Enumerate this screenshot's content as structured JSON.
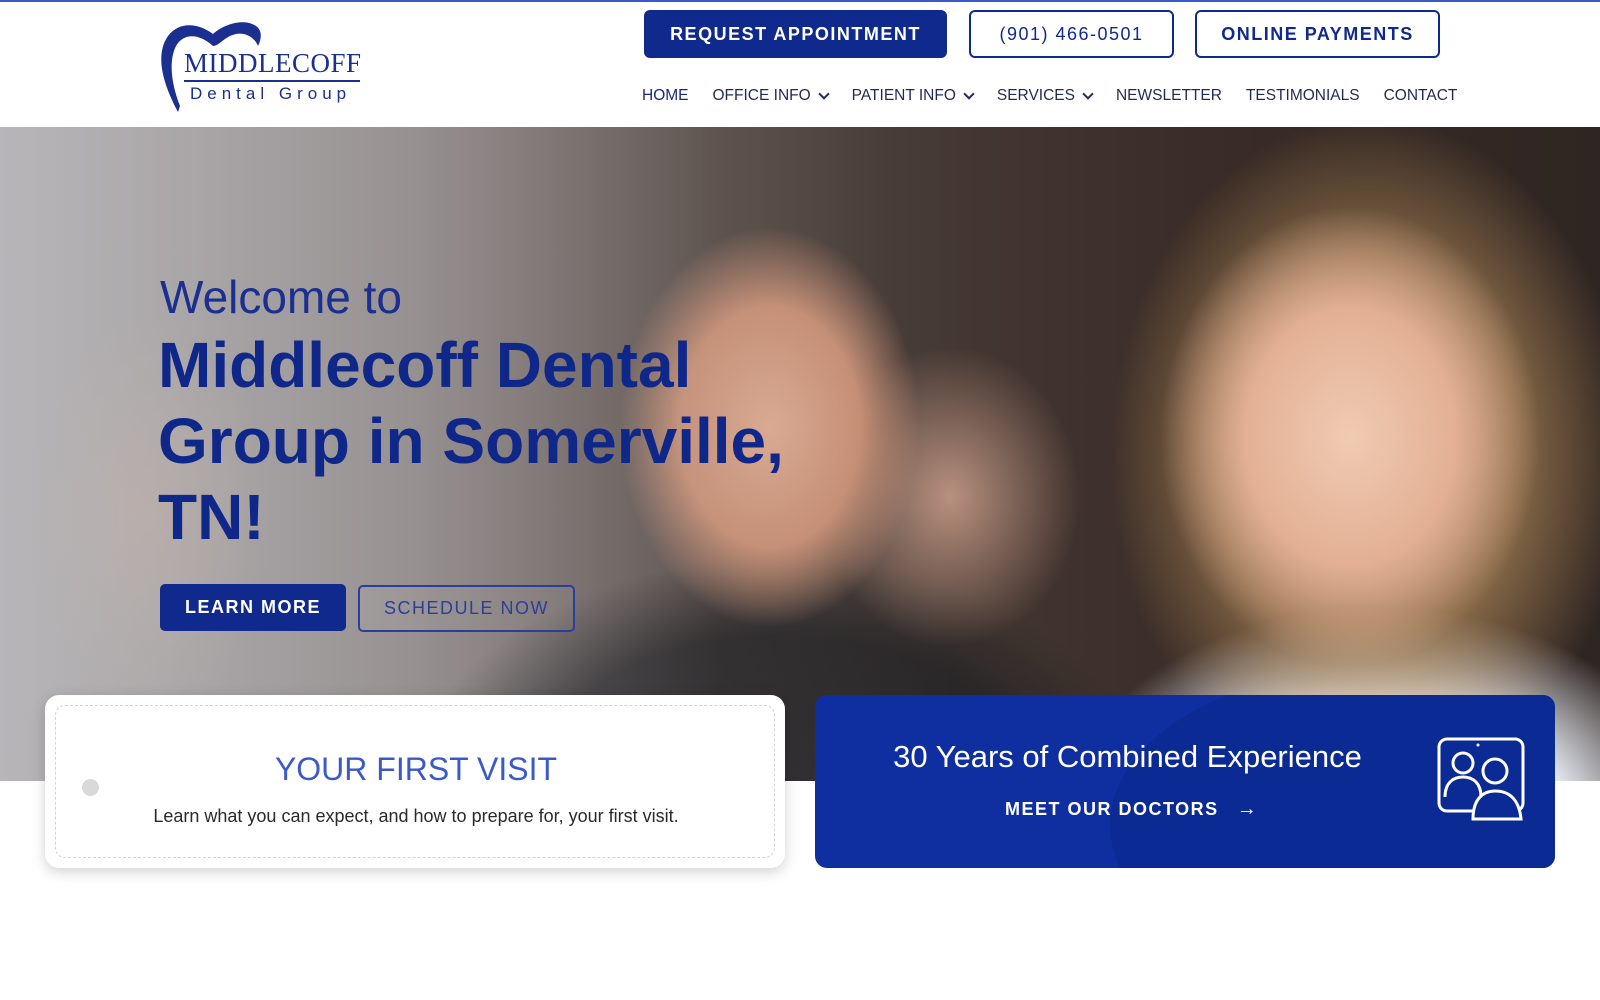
{
  "header": {
    "logo": {
      "name": "MIDDLECOFF",
      "sub": "Dental Group"
    },
    "request_label": "REQUEST APPOINTMENT",
    "phone_label": "(901) 466-0501",
    "payments_label": "ONLINE PAYMENTS",
    "nav": [
      {
        "label": "HOME",
        "dropdown": false
      },
      {
        "label": "OFFICE INFO",
        "dropdown": true
      },
      {
        "label": "PATIENT INFO",
        "dropdown": true
      },
      {
        "label": "SERVICES",
        "dropdown": true
      },
      {
        "label": "NEWSLETTER",
        "dropdown": false
      },
      {
        "label": "TESTIMONIALS",
        "dropdown": false
      },
      {
        "label": "CONTACT",
        "dropdown": false
      }
    ]
  },
  "hero": {
    "welcome": "Welcome to",
    "title": "Middlecoff Dental Group in Somerville, TN!",
    "learn_label": "LEARN MORE",
    "schedule_label": "SCHEDULE NOW"
  },
  "cards": {
    "visit": {
      "title": "YOUR FIRST VISIT",
      "text": "Learn what you can expect, and how to prepare for, your first visit."
    },
    "experience": {
      "title": "30 Years of Combined Experience",
      "link": "MEET OUR DOCTORS",
      "arrow": "→",
      "icon": "doctors-icon"
    }
  },
  "colors": {
    "brand_navy": "#0f2a8c",
    "brand_blue": "#3b59c9",
    "card_blue": "#0f2fa0"
  }
}
